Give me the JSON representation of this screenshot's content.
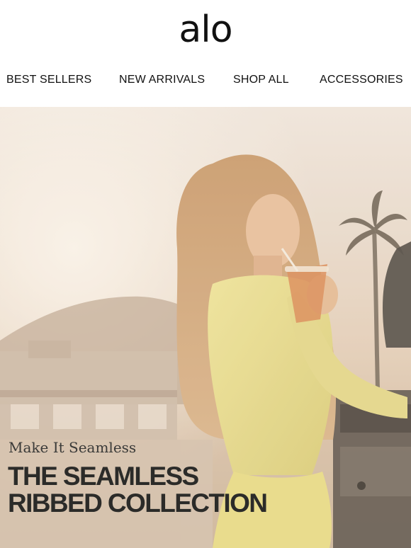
{
  "brand": {
    "logo_text": "alo"
  },
  "nav": {
    "items": [
      {
        "label": "BEST SELLERS"
      },
      {
        "label": "NEW ARRIVALS"
      },
      {
        "label": "SHOP ALL"
      },
      {
        "label": "ACCESSORIES"
      }
    ]
  },
  "hero": {
    "subtitle": "Make It Seamless",
    "title_line1": "THE SEAMLESS",
    "title_line2": "RIBBED COLLECTION",
    "colors": {
      "outfit": "#e6dc8a",
      "sky": "#efe7df",
      "text": "#2b2b29"
    }
  }
}
